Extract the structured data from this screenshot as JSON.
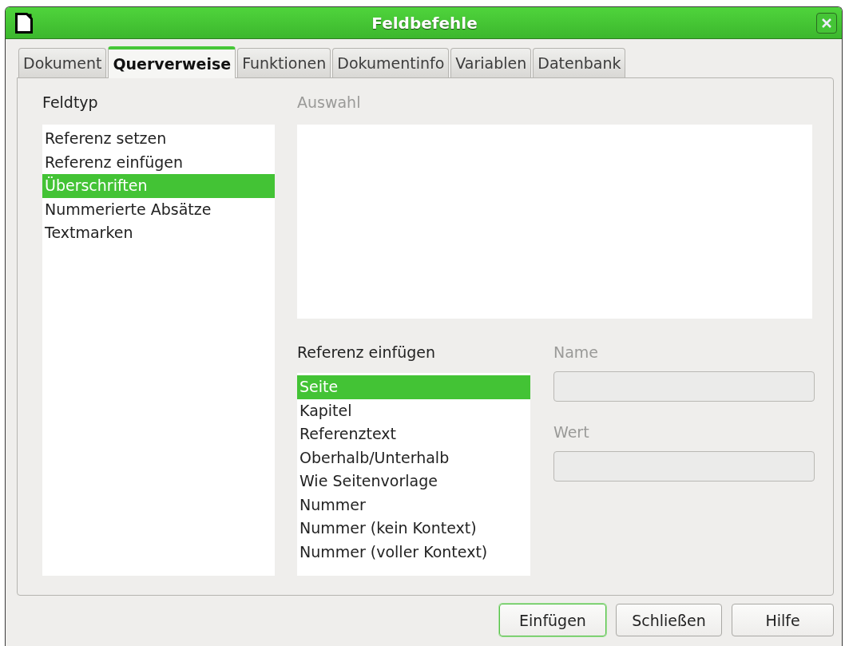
{
  "window": {
    "title": "Feldbefehle"
  },
  "tabs": [
    {
      "label": "Dokument",
      "selected": false
    },
    {
      "label": "Querverweise",
      "selected": true
    },
    {
      "label": "Funktionen",
      "selected": false
    },
    {
      "label": "Dokumentinfo",
      "selected": false
    },
    {
      "label": "Variablen",
      "selected": false
    },
    {
      "label": "Datenbank",
      "selected": false
    }
  ],
  "feldtyp": {
    "label": "Feldtyp",
    "items": [
      {
        "label": "Referenz setzen",
        "selected": false
      },
      {
        "label": "Referenz einfügen",
        "selected": false
      },
      {
        "label": "Überschriften",
        "selected": true
      },
      {
        "label": "Nummerierte Absätze",
        "selected": false
      },
      {
        "label": "Textmarken",
        "selected": false
      }
    ]
  },
  "auswahl": {
    "label": "Auswahl",
    "disabled": true
  },
  "referenz": {
    "label": "Referenz einfügen",
    "items": [
      {
        "label": "Seite",
        "selected": true
      },
      {
        "label": "Kapitel",
        "selected": false
      },
      {
        "label": "Referenztext",
        "selected": false
      },
      {
        "label": "Oberhalb/Unterhalb",
        "selected": false
      },
      {
        "label": "Wie Seitenvorlage",
        "selected": false
      },
      {
        "label": "Nummer",
        "selected": false
      },
      {
        "label": "Nummer (kein Kontext)",
        "selected": false
      },
      {
        "label": "Nummer (voller Kontext)",
        "selected": false
      }
    ]
  },
  "fields": [
    {
      "label": "Name",
      "disabled": true
    },
    {
      "label": "Wert",
      "disabled": true
    }
  ],
  "buttons": [
    {
      "label": "Einfügen",
      "default": true
    },
    {
      "label": "Schließen",
      "default": false
    },
    {
      "label": "Hilfe",
      "default": false
    }
  ]
}
